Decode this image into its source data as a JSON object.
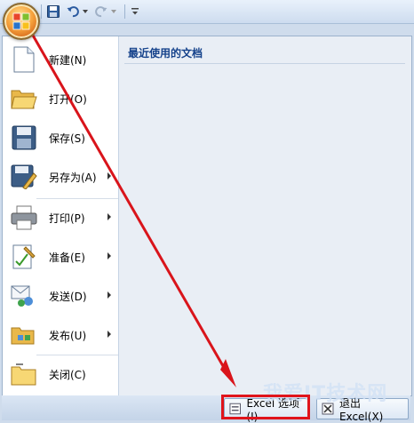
{
  "menu": {
    "items": [
      {
        "label": "新建(N)",
        "icon": "new-document-icon",
        "submenu": false
      },
      {
        "label": "打开(O)",
        "icon": "open-folder-icon",
        "submenu": false
      },
      {
        "label": "保存(S)",
        "icon": "save-icon",
        "submenu": false
      },
      {
        "label": "另存为(A)",
        "icon": "save-as-icon",
        "submenu": true
      },
      {
        "label": "打印(P)",
        "icon": "printer-icon",
        "submenu": true
      },
      {
        "label": "准备(E)",
        "icon": "prepare-icon",
        "submenu": true
      },
      {
        "label": "发送(D)",
        "icon": "send-icon",
        "submenu": true
      },
      {
        "label": "发布(U)",
        "icon": "publish-icon",
        "submenu": true
      },
      {
        "label": "关闭(C)",
        "icon": "close-folder-icon",
        "submenu": false
      }
    ]
  },
  "recent": {
    "title": "最近使用的文档"
  },
  "bottom": {
    "options_label": "Excel 选项(I)",
    "exit_label": "退出 Excel(X)"
  },
  "watermark": "我爱IT技术网",
  "colors": {
    "highlight": "#e0141b",
    "arrow": "#d9141b",
    "accent": "#15428b"
  }
}
